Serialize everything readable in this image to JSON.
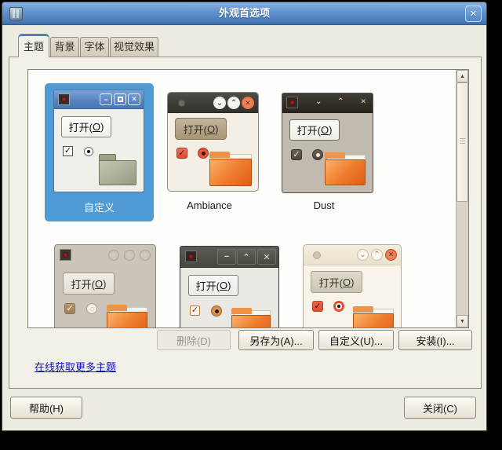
{
  "titlebar": {
    "title": "外观首选项"
  },
  "icons": {
    "close": "✕",
    "minimize": "−",
    "chevron_down": "⌄",
    "chevron_up": "⌃",
    "check": "✓",
    "arrow_up": "▲",
    "arrow_down": "▼"
  },
  "tabs": {
    "items": [
      {
        "label": "主题",
        "active": true
      },
      {
        "label": "背景",
        "active": false
      },
      {
        "label": "字体",
        "active": false
      },
      {
        "label": "视觉效果",
        "active": false
      }
    ]
  },
  "preview": {
    "open_prefix": "打开(",
    "open_mnemonic": "O",
    "open_suffix": ")"
  },
  "themes": {
    "items": [
      {
        "label": "自定义",
        "selected": true
      },
      {
        "label": "Ambiance",
        "selected": false
      },
      {
        "label": "Dust",
        "selected": false
      }
    ]
  },
  "actions": {
    "delete": "删除(D)",
    "save_as": "另存为(A)...",
    "customize": "自定义(U)...",
    "install": "安装(I)..."
  },
  "links": {
    "get_more": "在线获取更多主题"
  },
  "footer": {
    "help": "帮助(H)",
    "close": "关闭(C)"
  },
  "colors": {
    "selection_blue": "#509AD5",
    "titlebar_blue": "#5E92CD",
    "link_blue": "#0F0FBF",
    "folder_orange": "#EE7A2B"
  }
}
